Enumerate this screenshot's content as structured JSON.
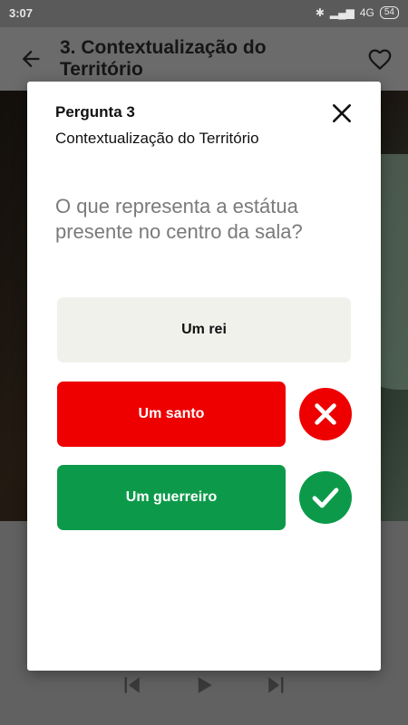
{
  "status_bar": {
    "time": "3:07",
    "network": "4G",
    "battery": "54"
  },
  "app_bar": {
    "title": "3. Contextualização do Território"
  },
  "dialog": {
    "question_number": "Pergunta 3",
    "category": "Contextualização do Território",
    "question": "O que representa a estátua presente no centro da sala?",
    "answers": [
      {
        "label": "Um rei",
        "state": "neutral"
      },
      {
        "label": "Um santo",
        "state": "wrong"
      },
      {
        "label": "Um guerreiro",
        "state": "correct"
      }
    ]
  },
  "colors": {
    "wrong": "#ef0000",
    "correct": "#0c9a4a",
    "neutral": "#f1f1ec"
  },
  "icons": {
    "back": "arrow-left-icon",
    "favorite": "heart-icon",
    "close": "close-icon",
    "wrong": "x-icon",
    "correct": "check-icon"
  }
}
